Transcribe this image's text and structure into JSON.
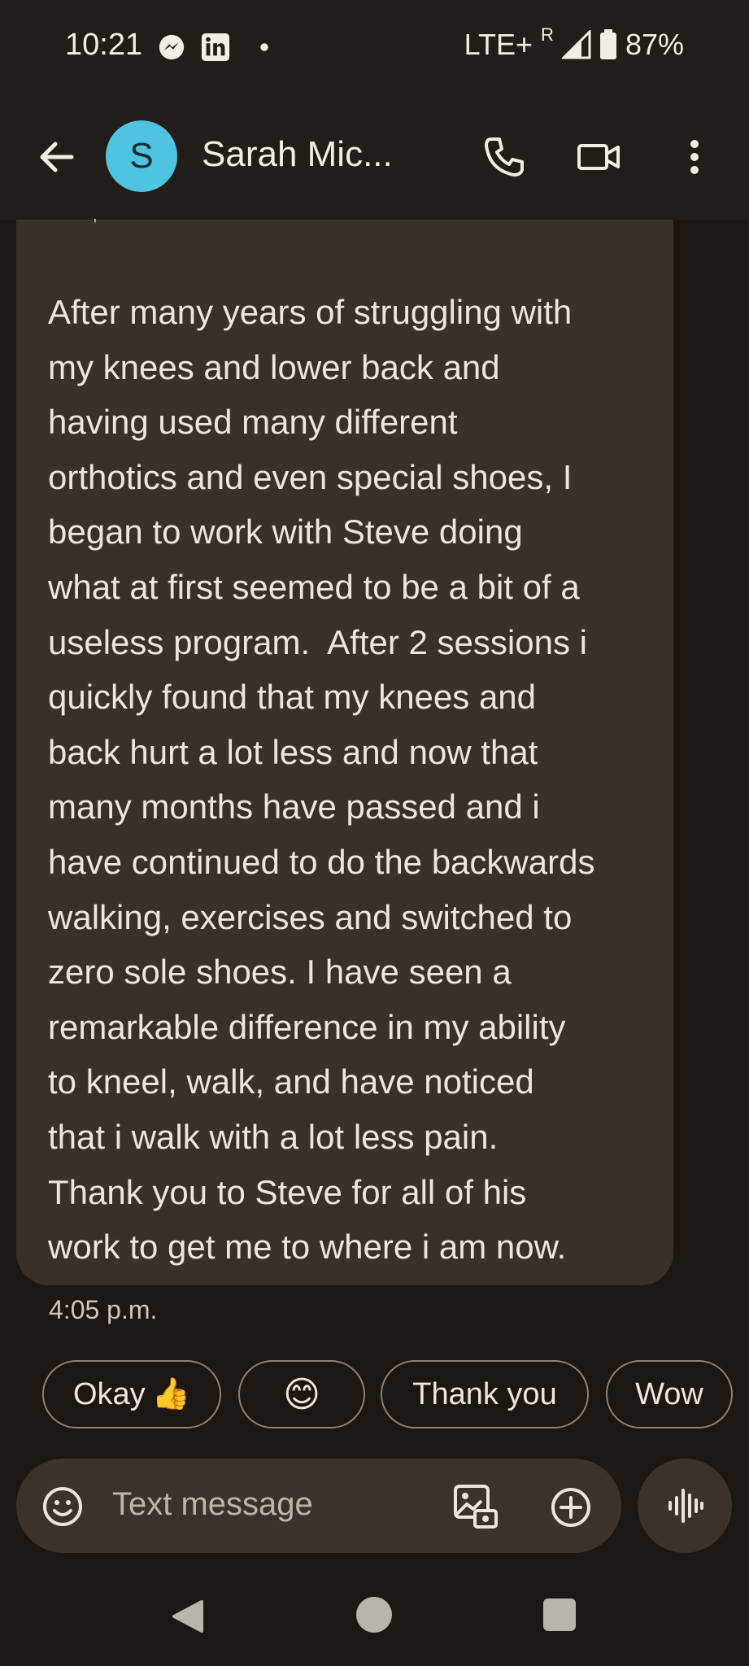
{
  "status_bar": {
    "time": "10:21",
    "network": "LTE+",
    "roaming": "R",
    "battery": "87%",
    "icons": [
      "messenger-icon",
      "linkedin-icon",
      "dot-icon",
      "signal-icon",
      "battery-icon"
    ]
  },
  "app_bar": {
    "avatar_letter": "S",
    "contact_name": "Sarah Mic..."
  },
  "message": {
    "top_mark": "'",
    "text": "After many years of struggling with\nmy knees and lower back and\nhaving used many different\northotics and even special shoes, I\nbegan to work with Steve doing\nwhat at first seemed to be a bit of a\nuseless program.  After 2 sessions i\nquickly found that my knees and\nback hurt a lot less and now that\nmany months have passed and i\nhave continued to do the backwards\nwalking, exercises and switched to\nzero sole shoes. I have seen a\nremarkable difference in my ability\nto kneel, walk, and have noticed\nthat i walk with a lot less pain.\nThank you to Steve for all of his\nwork to get me to where i am now.",
    "timestamp": "4:05 p.m."
  },
  "smart_replies": [
    {
      "label": "Okay",
      "emoji": "👍"
    },
    {
      "label": "",
      "emoji": "😊"
    },
    {
      "label": "Thank you",
      "emoji": ""
    },
    {
      "label": "Wow",
      "emoji": ""
    }
  ],
  "composer": {
    "placeholder": "Text message"
  },
  "colors": {
    "background": "#1c1712",
    "bubble": "#383029",
    "avatar": "#4fc3df",
    "text": "#ece6dd"
  }
}
